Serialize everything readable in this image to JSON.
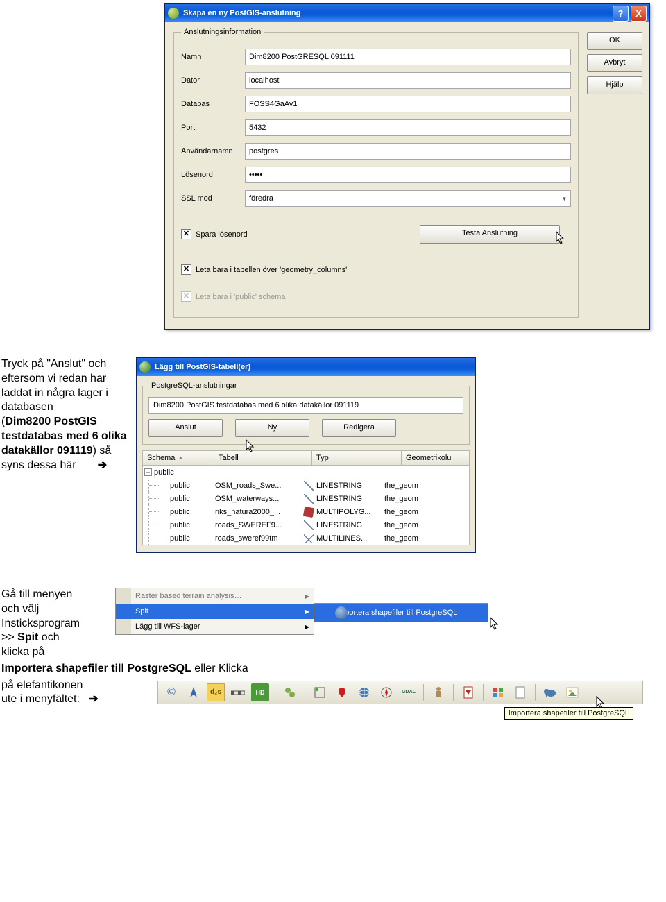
{
  "dialog1": {
    "title": "Skapa en ny PostGIS-anslutning",
    "help_glyph": "?",
    "close_glyph": "X",
    "fieldset_legend": "Anslutningsinformation",
    "rows": {
      "namn": {
        "label": "Namn",
        "value": "Dim8200 PostGRESQL 091111"
      },
      "dator": {
        "label": "Dator",
        "value": "localhost"
      },
      "databas": {
        "label": "Databas",
        "value": "FOSS4GaAv1"
      },
      "port": {
        "label": "Port",
        "value": "5432"
      },
      "user": {
        "label": "Användarnamn",
        "value": "postgres"
      },
      "pass": {
        "label": "Lösenord",
        "value": "•••••"
      },
      "ssl": {
        "label": "SSL mod",
        "value": "föredra"
      }
    },
    "chk_savepw": "Spara lösenord",
    "chk_geom": "Leta bara i tabellen över 'geometry_columns'",
    "chk_public": "Leta bara i 'public' schema",
    "test_btn": "Testa Anslutning",
    "ok": "OK",
    "cancel": "Avbryt",
    "help": "Hjälp"
  },
  "para1": {
    "l1": "Tryck på \"Anslut\" och",
    "l2": "eftersom vi redan har",
    "l3": "laddat in några lager i",
    "l4": "databasen",
    "l5": "(Dim8200 PostGIS",
    "l6": "testdatabas med 6 olika",
    "l7": "datakällor 091119) så",
    "l8": "syns dessa här",
    "arrow": "➔"
  },
  "dialog2": {
    "title": "Lägg till PostGIS-tabell(er)",
    "fieldset": "PostgreSQL-anslutningar",
    "dropdown": "Dim8200 PostGIS testdatabas med 6 olika datakällor 091119",
    "btn_connect": "Anslut",
    "btn_new": "Ny",
    "btn_edit": "Redigera",
    "columns": {
      "c1": "Schema",
      "c2": "Tabell",
      "c3": "Typ",
      "c4": "Geometrikolu"
    },
    "root": "public",
    "rows": [
      {
        "schema": "public",
        "table": "OSM_roads_Swe...",
        "type": "LINESTRING",
        "geom": "the_geom",
        "icon": "line"
      },
      {
        "schema": "public",
        "table": "OSM_waterways...",
        "type": "LINESTRING",
        "geom": "the_geom",
        "icon": "line"
      },
      {
        "schema": "public",
        "table": "riks_natura2000_...",
        "type": "MULTIPOLYG...",
        "geom": "the_geom",
        "icon": "poly"
      },
      {
        "schema": "public",
        "table": "roads_SWEREF9...",
        "type": "LINESTRING",
        "geom": "the_geom",
        "icon": "line"
      },
      {
        "schema": "public",
        "table": "roads_sweref99tm",
        "type": "MULTILINES...",
        "geom": "the_geom",
        "icon": "multi"
      }
    ]
  },
  "para2": {
    "l1": "Gå till menyen",
    "l2": "och välj",
    "l3": "Insticksprogram",
    "l4": ">> Spit och",
    "l5": "klicka på"
  },
  "menu": {
    "item1": "Raster based terrain analysis…",
    "item2": "Spit",
    "item3": "Lägg till WFS-lager",
    "sub": "Importera shapefiler till PostgreSQL"
  },
  "para3": {
    "line": "Importera shapefiler till PostgreSQL eller Klicka",
    "l2": "på elefantikonen",
    "l3": "ute i menyfältet:",
    "arrow": "➔"
  },
  "tooltip": "Importera shapefiler till PostgreSQL"
}
